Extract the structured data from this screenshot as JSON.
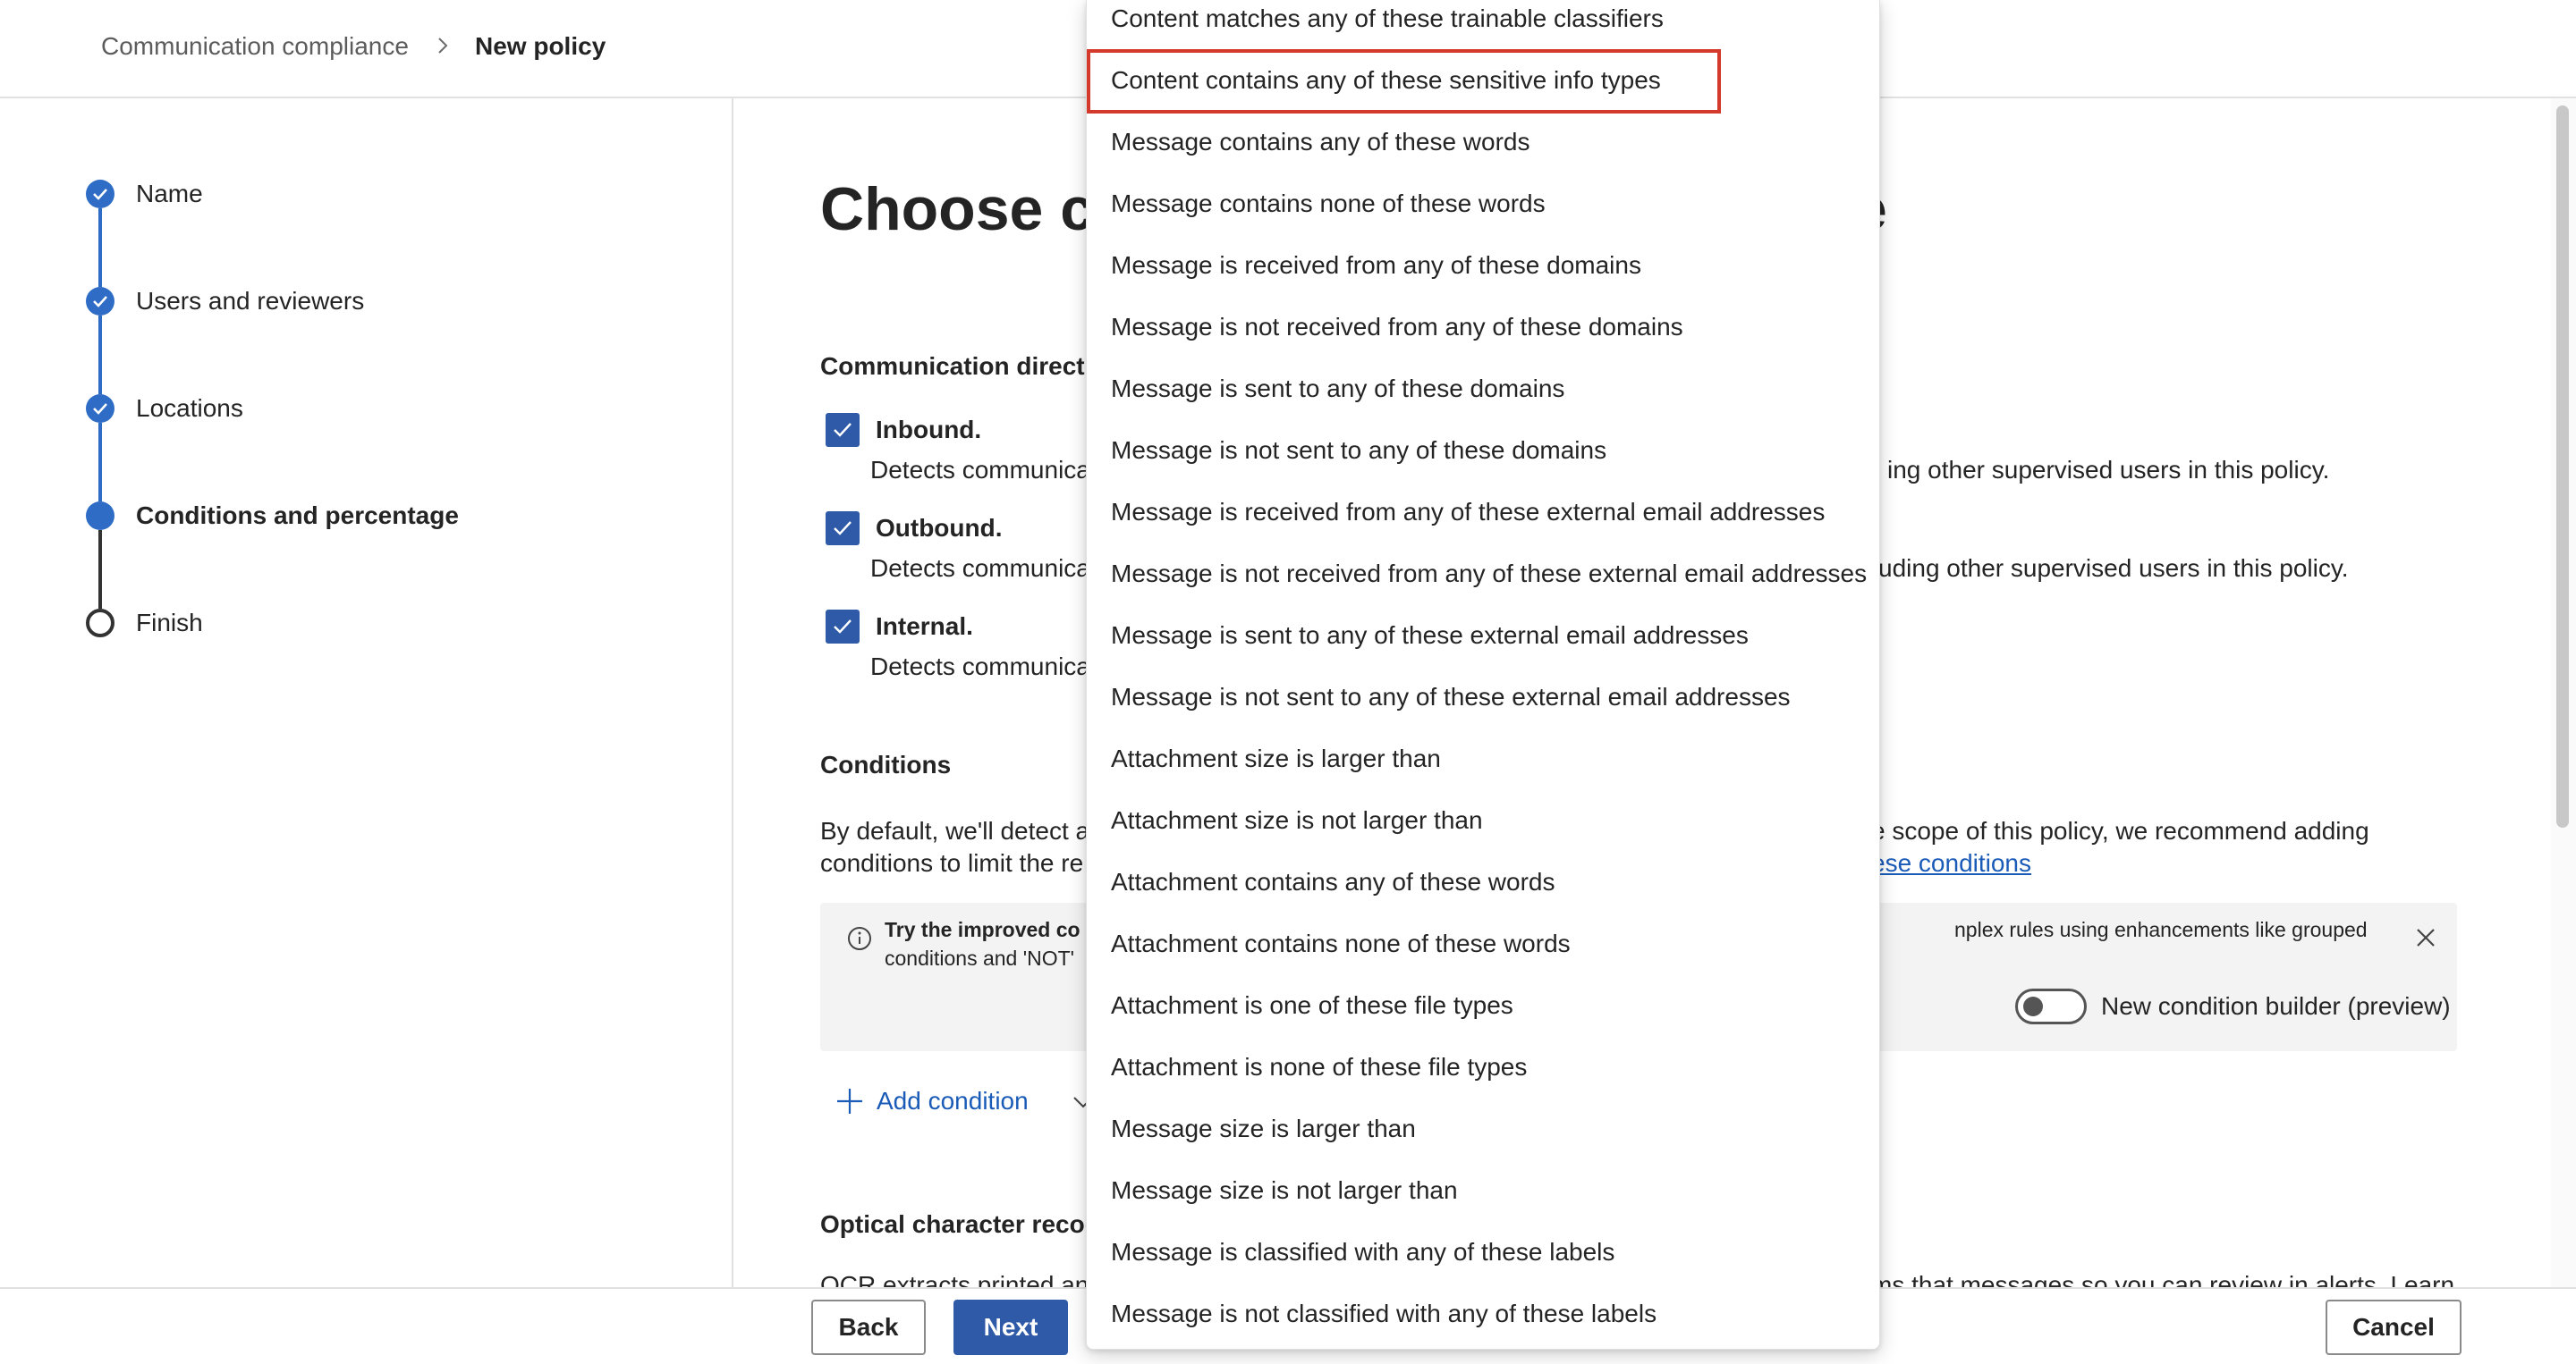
{
  "breadcrumb": {
    "parent": "Communication compliance",
    "current": "New policy"
  },
  "steps": [
    {
      "label": "Name",
      "status": "done"
    },
    {
      "label": "Users and reviewers",
      "status": "done"
    },
    {
      "label": "Locations",
      "status": "done"
    },
    {
      "label": "Conditions and percentage",
      "status": "current"
    },
    {
      "label": "Finish",
      "status": "todo"
    }
  ],
  "main": {
    "title_visible": "Choose co",
    "title_tail": "e",
    "direction_heading": "Communication directi",
    "directions": [
      {
        "label": "Inbound.",
        "checked": true,
        "desc_visible": "Detects communica",
        "desc_tail": "ing other supervised users in this policy."
      },
      {
        "label": "Outbound.",
        "checked": true,
        "desc_visible": "Detects communica",
        "desc_tail": "uding other supervised users in this policy."
      },
      {
        "label": "Internal.",
        "checked": true,
        "desc_visible": "Detects communica",
        "desc_tail": ""
      }
    ],
    "conditions_heading": "Conditions",
    "conditions_line1_visible": "By default, we'll detect a",
    "conditions_line1_tail": "e scope of this policy, we recommend adding",
    "conditions_line2_visible": "conditions to limit the re",
    "conditions_link_tail": "ese conditions",
    "info": {
      "line1_visible": "Try the improved co",
      "line1_tail": "nplex rules using enhancements like grouped",
      "line2_visible": "conditions and 'NOT'",
      "toggle_label": "New condition builder (preview)",
      "toggle_on": false
    },
    "add_condition_label": "Add condition",
    "ocr_heading": "Optical character recog",
    "ocr_text_cut": "OCR extracts printed and",
    "ocr_text_tail": "ms that messages so you can review in alerts. Learn"
  },
  "footer": {
    "back_label": "Back",
    "next_label": "Next",
    "cancel_label": "Cancel"
  },
  "condition_menu": {
    "highlighted_index": 1,
    "items": [
      "Content matches any of these trainable classifiers",
      "Content contains any of these sensitive info types",
      "Message contains any of these words",
      "Message contains none of these words",
      "Message is received from any of these domains",
      "Message is not received from any of these domains",
      "Message is sent to any of these domains",
      "Message is not sent to any of these domains",
      "Message is received from any of these external email addresses",
      "Message is not received from any of these external email addresses",
      "Message is sent to any of these external email addresses",
      "Message is not sent to any of these external email addresses",
      "Attachment size is larger than",
      "Attachment size is not larger than",
      "Attachment contains any of these words",
      "Attachment contains none of these words",
      "Attachment is one of these file types",
      "Attachment is none of these file types",
      "Message size is larger than",
      "Message size is not larger than",
      "Message is classified with any of these labels",
      "Message is not classified with any of these labels"
    ]
  },
  "colors": {
    "accent": "#2f5aa8",
    "step_blue": "#2f6cc5",
    "link": "#1a5bb8",
    "highlight_border": "#d33a2c"
  }
}
